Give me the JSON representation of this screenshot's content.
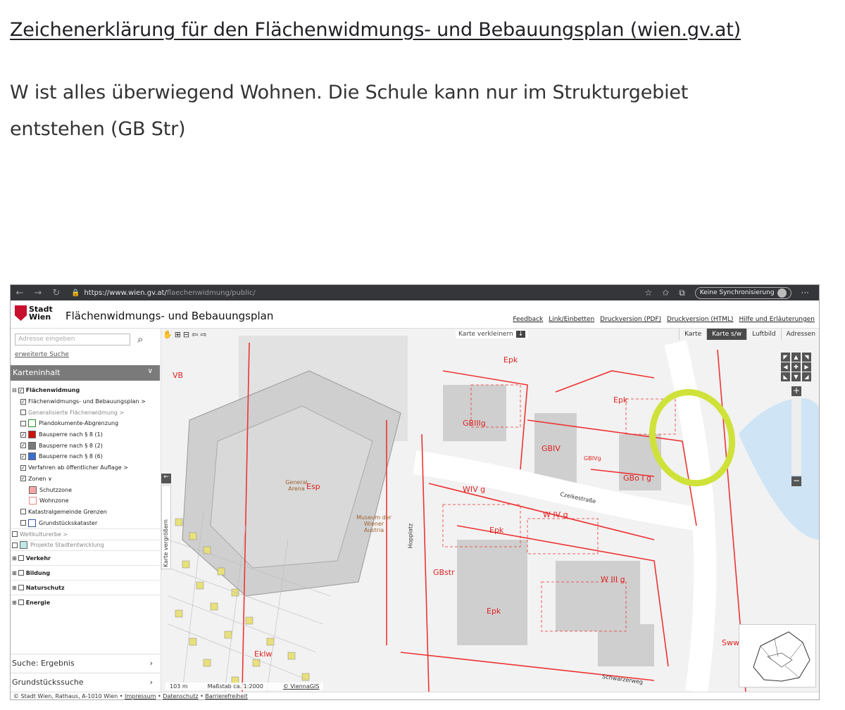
{
  "post": {
    "link_text": "Zeichenerklärung für den Flächenwidmungs- und Bebauungsplan (wien.gv.at)",
    "body_text": "W ist alles überwiegend Wohnen. Die Schule kann nur im Strukturgebiet entstehen (GB Str)"
  },
  "browser": {
    "url_host": "https://www.wien.gv.at/",
    "url_path": "flaechenwidmung/public/",
    "sync_label": "Keine Synchronisierung",
    "more": "···"
  },
  "app": {
    "logo_line1": "Stadt",
    "logo_line2": "Wien",
    "title": "Flächenwidmungs- und Bebauungsplan",
    "links": [
      "Feedback",
      "Link/Einbetten",
      "Druckversion (PDF)",
      "Druckversion (HTML)",
      "Hilfe und Erläuterungen"
    ]
  },
  "sidebar": {
    "search_placeholder": "Adresse eingeben",
    "extended_search": "erweiterte Suche",
    "panel_title": "Karteninhalt",
    "items": [
      {
        "label": "Flächenwidmung",
        "indent": 0,
        "checked": true,
        "bold": true,
        "expand": "⊟"
      },
      {
        "label": "Flächenwidmungs- und Bebauungsplan >",
        "indent": 1,
        "checked": true
      },
      {
        "label": "Generalisierte Flächenwidmung >",
        "indent": 1,
        "checked": false,
        "grey": true
      },
      {
        "label": "Plandokumente-Abgrenzung",
        "indent": 1,
        "checked": false,
        "swatch": "#ffffff",
        "swatch_border": "#2a8a2a"
      },
      {
        "label": "Bausperre nach § 8 (1)",
        "indent": 1,
        "checked": true,
        "swatch": "#cc1111"
      },
      {
        "label": "Bausperre nach § 8 (2)",
        "indent": 1,
        "checked": true,
        "swatch": "#7a7a7a"
      },
      {
        "label": "Bausperre nach § 8 (6)",
        "indent": 1,
        "checked": true,
        "swatch": "#3a6fd0"
      },
      {
        "label": "Verfahren ab öffentlicher Auflage >",
        "indent": 1,
        "checked": true
      },
      {
        "label": "Zonen ∨",
        "indent": 1,
        "checked": true
      },
      {
        "label": "Schutzzone",
        "indent": 2,
        "swatch": "#f4a6a6"
      },
      {
        "label": "Wohnzone",
        "indent": 2,
        "swatch": "#ffffff",
        "swatch_border": "#e88"
      },
      {
        "label": "Katastralgemeinde Grenzen",
        "indent": 1,
        "checked": false
      },
      {
        "label": "Grundstückskataster",
        "indent": 1,
        "checked": false,
        "swatch": "#ffffff",
        "swatch_border": "#3355aa"
      },
      {
        "label": "Weltkulturerbe >",
        "indent": 0,
        "checked": false,
        "grey": true
      },
      {
        "label": "Projekte Stadtentwicklung",
        "indent": 0,
        "checked": false,
        "grey": true,
        "swatch": "#bfe8e8"
      },
      {
        "label": "Verkehr",
        "indent": 0,
        "checked": false,
        "bold": true,
        "expand": "⊞"
      },
      {
        "label": "Bildung",
        "indent": 0,
        "checked": false,
        "bold": true,
        "expand": "⊞"
      },
      {
        "label": "Naturschutz",
        "indent": 0,
        "checked": false,
        "bold": true,
        "expand": "⊞"
      },
      {
        "label": "Energie",
        "indent": 0,
        "checked": false,
        "bold": true,
        "expand": "⊞"
      }
    ],
    "bottom1": "Suche: Ergebnis",
    "bottom2": "Grundstückssuche"
  },
  "map": {
    "shrink_label": "Karte verkleinern",
    "types": [
      "Karte",
      "Karte s/w",
      "Luftbild",
      "Adressen"
    ],
    "selected_type": "Karte s/w",
    "side_tab": "Karte vergrößern",
    "scale_distance": "103 m",
    "scale_label": "Maßstab ca. 1:2000",
    "copyright": "© ViennaGIS",
    "labels": [
      {
        "text": "VB"
      },
      {
        "text": "Esp"
      },
      {
        "text": "Epk"
      },
      {
        "text": "Epk"
      },
      {
        "text": "Epk"
      },
      {
        "text": "Epk"
      },
      {
        "text": "GBIIIg"
      },
      {
        "text": "GBIV"
      },
      {
        "text": "GBIVg"
      },
      {
        "text": "GBo I g"
      },
      {
        "text": "W IV g"
      },
      {
        "text": "WIV g"
      },
      {
        "text": "W III g"
      },
      {
        "text": "GBstr"
      },
      {
        "text": "Sww"
      },
      {
        "text": "Eklw"
      },
      {
        "text": "Hopplatz"
      },
      {
        "text": "Czeikestraße"
      },
      {
        "text": "Schwarzerweg"
      },
      {
        "text": "General Arena"
      },
      {
        "text": "Museum der Wiener Austria"
      }
    ]
  },
  "footer": {
    "prefix": "© Stadt Wien, Rathaus, A-1010 Wien •",
    "link1": "Impressum",
    "link2": "Datenschutz",
    "link3": "Barrierefreiheit"
  }
}
